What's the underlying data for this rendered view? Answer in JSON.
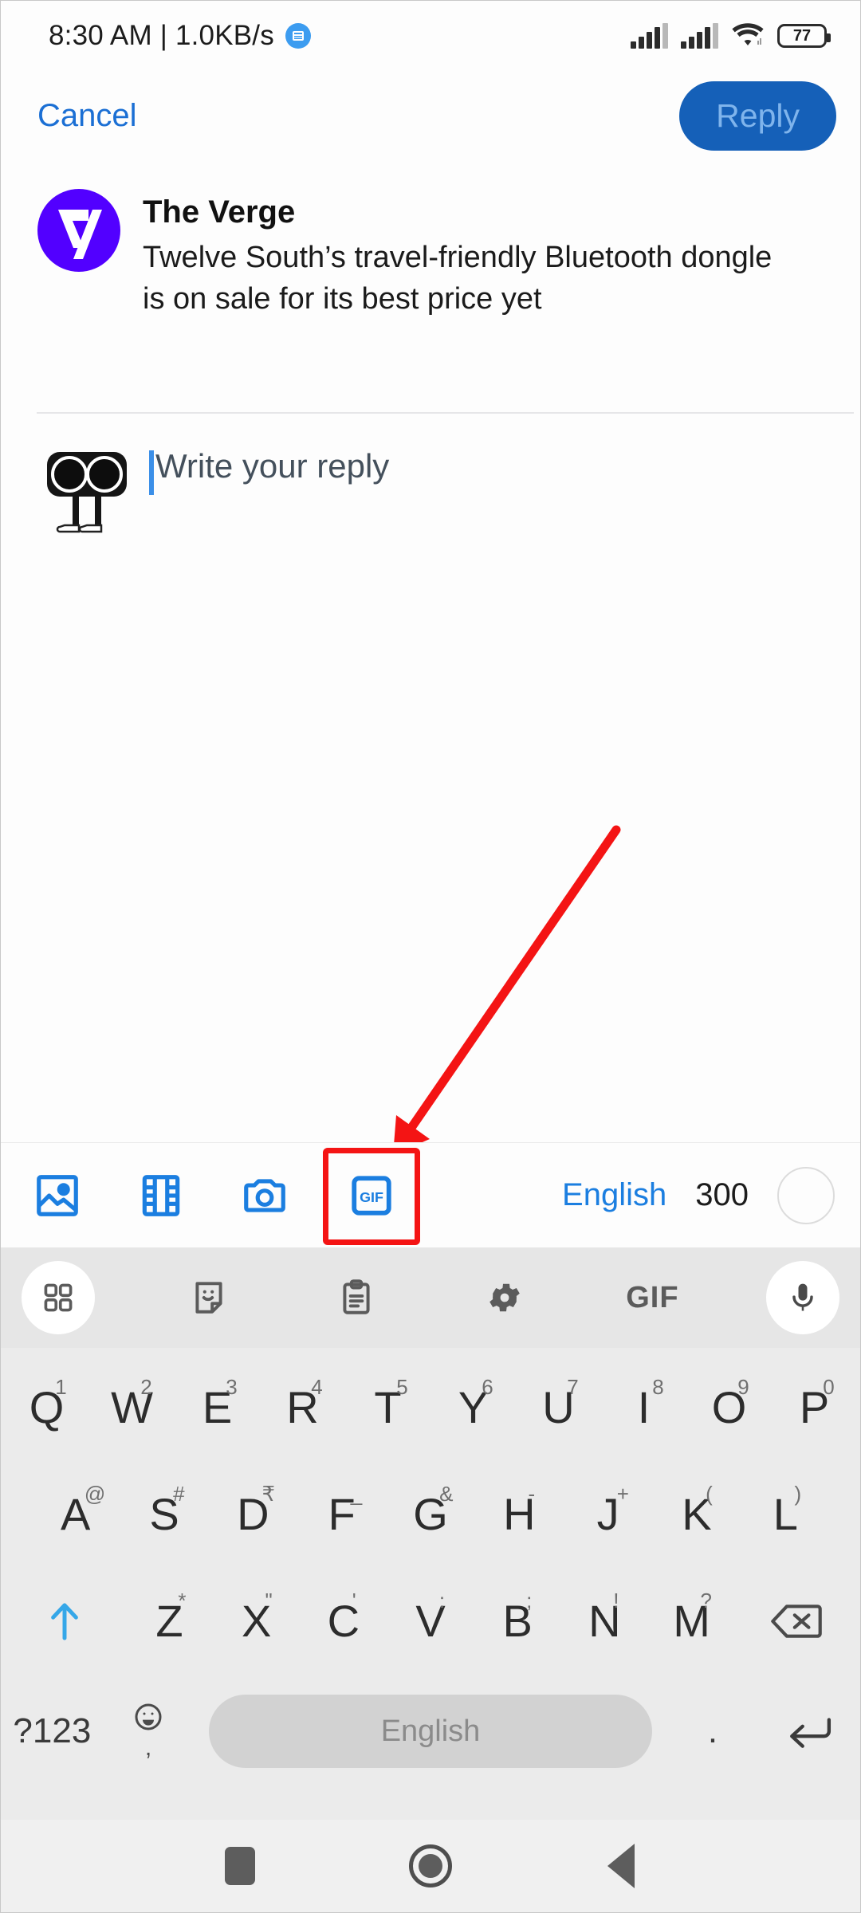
{
  "status_bar": {
    "time_text": "8:30 AM | 1.0KB/s",
    "network_badge_icon": "data-saver-icon",
    "signal_icon_1": "signal-bars-icon",
    "signal_icon_2": "signal-bars-icon",
    "wifi_icon": "wifi-icon",
    "battery_level": "77"
  },
  "app_bar": {
    "cancel_label": "Cancel",
    "reply_label": "Reply",
    "reply_bg_color": "#1560b8",
    "reply_text_color": "#7fb4ec",
    "cancel_color": "#1b6fd4"
  },
  "quoted_tweet": {
    "avatar_icon": "the-verge-logo-icon",
    "avatar_color": "#5200ff",
    "author_name": "The Verge",
    "text": "Twelve South’s travel-friendly Bluetooth dongle is on sale for its best price yet"
  },
  "compose": {
    "avatar_icon": "user-avatar-icon",
    "placeholder": "Write your reply",
    "caret_color": "#3b8fe8",
    "value": ""
  },
  "annotation": {
    "type": "red-arrow",
    "color": "#f41414",
    "points_to": "gif-attachment-button"
  },
  "attach_bar": {
    "items": [
      {
        "name": "image-icon",
        "label": "Image"
      },
      {
        "name": "video-icon",
        "label": "Video"
      },
      {
        "name": "camera-icon",
        "label": "Camera"
      },
      {
        "name": "gif-icon",
        "label": "GIF",
        "highlighted": true
      }
    ],
    "gif_label": "GIF",
    "language_label": "English",
    "char_count": "300",
    "accent_color": "#1b7ee0",
    "highlight_color": "#f41414"
  },
  "keyboard": {
    "toolbar": [
      {
        "name": "apps-grid-icon",
        "circled": true
      },
      {
        "name": "sticker-icon",
        "circled": false
      },
      {
        "name": "clipboard-icon",
        "circled": false
      },
      {
        "name": "settings-gear-icon",
        "circled": false
      },
      {
        "name": "gif-icon",
        "circled": false,
        "text": "GIF"
      },
      {
        "name": "microphone-icon",
        "circled": true
      }
    ],
    "row1": [
      {
        "key": "Q",
        "sup": "1"
      },
      {
        "key": "W",
        "sup": "2"
      },
      {
        "key": "E",
        "sup": "3"
      },
      {
        "key": "R",
        "sup": "4"
      },
      {
        "key": "T",
        "sup": "5"
      },
      {
        "key": "Y",
        "sup": "6"
      },
      {
        "key": "U",
        "sup": "7"
      },
      {
        "key": "I",
        "sup": "8"
      },
      {
        "key": "O",
        "sup": "9"
      },
      {
        "key": "P",
        "sup": "0"
      }
    ],
    "row2": [
      {
        "key": "A",
        "sup": "@"
      },
      {
        "key": "S",
        "sup": "#"
      },
      {
        "key": "D",
        "sup": "₹"
      },
      {
        "key": "F",
        "sup": "_"
      },
      {
        "key": "G",
        "sup": "&"
      },
      {
        "key": "H",
        "sup": "-"
      },
      {
        "key": "J",
        "sup": "+"
      },
      {
        "key": "K",
        "sup": "("
      },
      {
        "key": "L",
        "sup": ")"
      }
    ],
    "row3": [
      {
        "key": "Z",
        "sup": "*"
      },
      {
        "key": "X",
        "sup": "\""
      },
      {
        "key": "C",
        "sup": "'"
      },
      {
        "key": "V",
        "sup": ":"
      },
      {
        "key": "B",
        "sup": ";"
      },
      {
        "key": "N",
        "sup": "!"
      },
      {
        "key": "M",
        "sup": "?"
      }
    ],
    "shift_icon": "shift-arrow-icon",
    "shift_color": "#35a7e8",
    "backspace_icon": "backspace-icon",
    "symbols_label": "?123",
    "emoji_icon": "emoji-icon",
    "comma_label": ",",
    "space_label": "English",
    "period_label": ".",
    "enter_icon": "enter-arrow-icon"
  },
  "nav_bar": {
    "recents_icon": "recents-square-icon",
    "home_icon": "home-circle-icon",
    "back_icon": "back-triangle-icon"
  }
}
